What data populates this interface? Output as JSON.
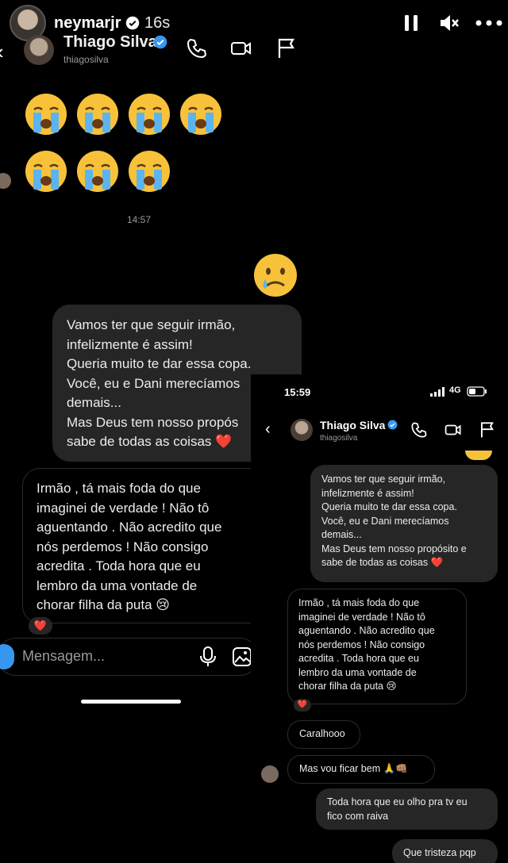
{
  "story": {
    "username": "neymarjr",
    "time_ago": "16s"
  },
  "chat": {
    "contact_name": "Thiago Silva",
    "contact_handle": "thiagosilva",
    "timestamp": "14:57",
    "messages": {
      "sent_1": [
        "Vamos ter que seguir irmão,",
        "infelizmente é assim!",
        "Queria muito te dar essa copa.",
        "Você, eu e Dani merecíamos",
        "demais...",
        "Mas Deus tem nosso propós",
        "sabe de todas as coisas ❤️"
      ],
      "received_1": [
        "Irmão , tá mais foda do que",
        "imaginei de verdade ! Não tô",
        "aguentando . Não acredito que",
        "nós perdemos ! Não consigo",
        "acredita . Toda hora que eu",
        "lembro da uma vontade de",
        "chorar filha da puta 😢"
      ],
      "reaction": "❤️"
    },
    "input_placeholder": "Mensagem..."
  },
  "overlay": {
    "status_time": "15:59",
    "network": "4G",
    "contact_name": "Thiago Silva",
    "contact_handle": "thiagosilva",
    "sent_1": [
      "Vamos ter que seguir irmão,",
      "infelizmente é assim!",
      "Queria muito te dar essa copa.",
      "Você, eu e Dani merecíamos",
      "demais...",
      "Mas Deus tem nosso propósito e",
      "sabe de todas as coisas ❤️"
    ],
    "received_1": [
      "Irmão , tá mais foda do que",
      "imaginei de verdade ! Não tô",
      "aguentando . Não acredito que",
      "nós perdemos ! Não consigo",
      "acredita . Toda hora que eu",
      "lembro da uma vontade de",
      "chorar filha da puta 😢"
    ],
    "reaction": "❤️",
    "received_2": "Caralhooo",
    "received_3": "Mas vou ficar bem 🙏👊🏽",
    "sent_2": [
      "Toda hora que eu olho pra tv eu",
      "fico com raiva"
    ],
    "sent_3": "Que tristeza pqp"
  },
  "colors": {
    "background": "#000000",
    "bubble_gray": "#262626",
    "verified_blue": "#3797f0",
    "heart_red": "#ed1c3a"
  },
  "icons": [
    "pause-icon",
    "mute-icon",
    "more-icon",
    "phone-icon",
    "video-icon",
    "flag-icon",
    "camera-icon",
    "mic-icon",
    "gallery-icon",
    "crying-face-emoji",
    "sad-face-emoji"
  ]
}
